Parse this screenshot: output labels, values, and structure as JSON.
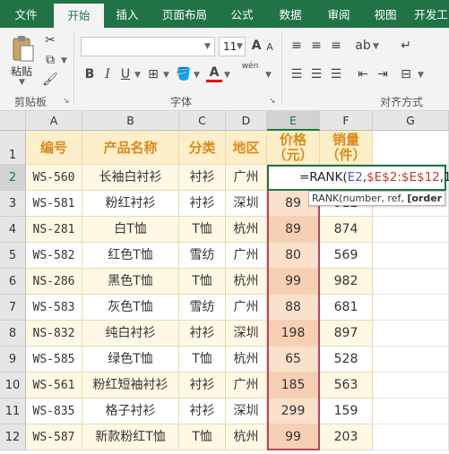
{
  "tabs": [
    "文件",
    "开始",
    "插入",
    "页面布局",
    "公式",
    "数据",
    "审阅",
    "视图",
    "开发工"
  ],
  "ribbon": {
    "paste_label": "粘贴",
    "clipboard_label": "剪贴板",
    "font_label": "字体",
    "align_label": "对齐方式",
    "font_size": "11",
    "bold": "B",
    "italic": "I",
    "underline": "U",
    "grow_font": "A",
    "shrink_font": "A",
    "phonetic": "wén"
  },
  "columns": [
    "A",
    "B",
    "C",
    "D",
    "E",
    "F",
    "G"
  ],
  "rows": [
    "1",
    "2",
    "3",
    "4",
    "5",
    "6",
    "7",
    "8",
    "9",
    "10",
    "11",
    "12"
  ],
  "header_row": [
    "编号",
    "产品名称",
    "分类",
    "地区",
    "价格\n（元）",
    "销量\n（件）"
  ],
  "data_rows": [
    [
      "WS-560",
      "长袖白衬衫",
      "衬衫",
      "广州",
      "",
      ""
    ],
    [
      "WS-581",
      "粉红衬衫",
      "衬衫",
      "深圳",
      "89",
      "912"
    ],
    [
      "NS-281",
      "白T恤",
      "T恤",
      "杭州",
      "89",
      "874"
    ],
    [
      "WS-582",
      "红色T恤",
      "雪纺",
      "广州",
      "80",
      "569"
    ],
    [
      "NS-286",
      "黑色T恤",
      "T恤",
      "杭州",
      "99",
      "982"
    ],
    [
      "WS-583",
      "灰色T恤",
      "雪纺",
      "广州",
      "88",
      "681"
    ],
    [
      "NS-832",
      "纯白衬衫",
      "衬衫",
      "深圳",
      "198",
      "897"
    ],
    [
      "WS-585",
      "绿色T恤",
      "T恤",
      "杭州",
      "65",
      "528"
    ],
    [
      "WS-561",
      "粉红短袖衬衫",
      "衬衫",
      "广州",
      "185",
      "563"
    ],
    [
      "WS-835",
      "格子衬衫",
      "衬衫",
      "深圳",
      "299",
      "159"
    ],
    [
      "WS-587",
      "新款粉红T恤",
      "T恤",
      "杭州",
      "99",
      "203"
    ]
  ],
  "formula": {
    "prefix": "=RANK(",
    "arg1": "E2",
    "comma1": ",",
    "arg2": "$E$2:$E$12",
    "tail": ",1)"
  },
  "tooltip": {
    "func": "RANK(",
    "params": "number, ref, ",
    "optional": "[order"
  },
  "colors": {
    "ribbon_green": "#217346",
    "header_fill": "#fdefc9",
    "header_text": "#d98a1c",
    "price_fill": "#fbe0cc",
    "range_border": "#b7455f"
  }
}
